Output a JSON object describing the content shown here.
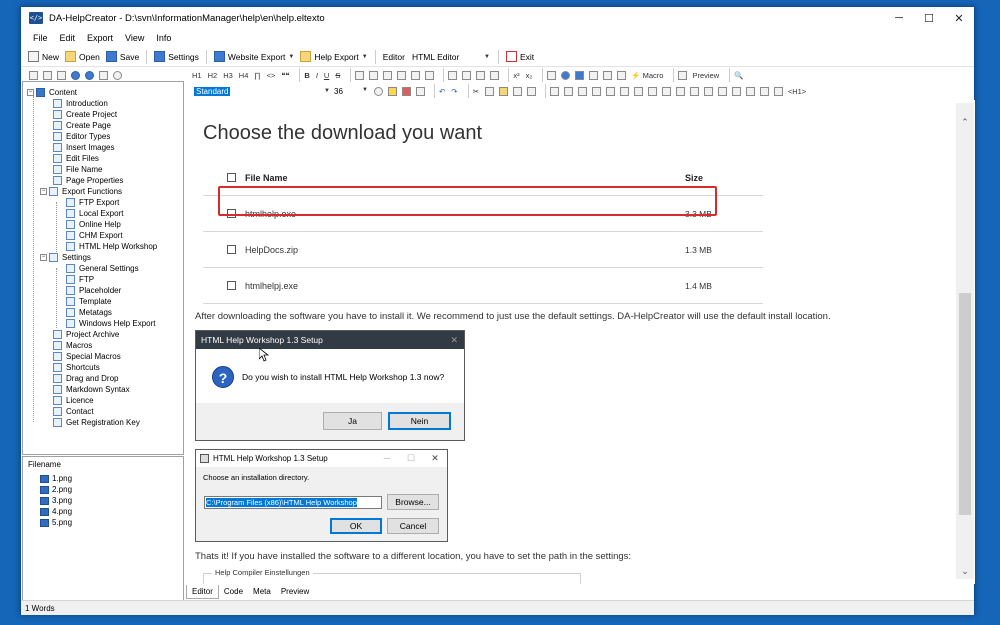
{
  "window": {
    "title": "DA-HelpCreator - D:\\svn\\InformationManager\\help\\en\\help.eltexto",
    "app_icon": "</>",
    "controls": {
      "minimize": "─",
      "maximize": "☐",
      "close": "✕"
    }
  },
  "menu": [
    "File",
    "Edit",
    "Export",
    "View",
    "Info"
  ],
  "toolbar": {
    "new": "New",
    "open": "Open",
    "save": "Save",
    "settings": "Settings",
    "website_export": "Website Export",
    "help_export": "Help Export",
    "editor_label": "Editor",
    "editor_value": "HTML Editor",
    "exit": "Exit"
  },
  "format_toolbar": {
    "items": [
      "H1",
      "H2",
      "H3",
      "H4",
      "∏",
      "<>",
      "❝❝",
      "B",
      "I",
      "U",
      "S",
      "x²",
      "x₂",
      "Macro",
      "Preview"
    ]
  },
  "style_toolbar": {
    "style": "Standard",
    "size": "36",
    "tag": "<H1>"
  },
  "tree": {
    "root": "Content",
    "items": [
      "Introduction",
      "Create Project",
      "Create Page",
      "Editor Types",
      "Insert Images",
      "Edit Files",
      "File Name",
      "Page Properties"
    ],
    "export_folder": "Export Functions",
    "export_items": [
      "FTP Export",
      "Local Export",
      "Online Help",
      "CHM Export",
      "HTML Help Workshop"
    ],
    "settings_folder": "Settings",
    "settings_items": [
      "General Settings",
      "FTP",
      "Placeholder",
      "Template",
      "Metatags",
      "Windows Help Export"
    ],
    "more_items": [
      "Project Archive",
      "Macros",
      "Special Macros",
      "Shortcuts",
      "Drag and Drop",
      "Markdown Syntax",
      "Licence",
      "Contact",
      "Get Registration Key"
    ]
  },
  "files": {
    "header": "Filename",
    "items": [
      "1.png",
      "2.png",
      "3.png",
      "4.png",
      "5.png"
    ]
  },
  "document": {
    "heading": "Choose the download you want",
    "table": {
      "col_name": "File Name",
      "col_size": "Size",
      "rows": [
        {
          "name": "htmlhelp.exe",
          "size": "3.3 MB"
        },
        {
          "name": "HelpDocs.zip",
          "size": "1.3 MB"
        },
        {
          "name": "htmlhelpj.exe",
          "size": "1.4 MB"
        }
      ]
    },
    "para1": "After downloading the software you have to install it. We recommend to just use the default settings. DA-HelpCreator will use the default install location.",
    "dialog1": {
      "title": "HTML Help Workshop 1.3 Setup",
      "close": "✕",
      "message": "Do you wish to install HTML Help Workshop 1.3 now?",
      "yes": "Ja",
      "no": "Nein"
    },
    "dialog2": {
      "title": "HTML Help Workshop 1.3 Setup",
      "label": "Choose an installation directory.",
      "path": "C:\\Program Files (x86)\\HTML Help Workshop",
      "browse": "Browse...",
      "ok": "OK",
      "cancel": "Cancel",
      "controls": {
        "minimize": "─",
        "maximize": "☐",
        "close": "✕"
      }
    },
    "para2": "Thats it! If you have installed the software to a different location, you have to set the path in the settings:",
    "fieldset_legend": "Help Compiler Einstellungen"
  },
  "editor_tabs": [
    "Editor",
    "Code",
    "Meta",
    "Preview"
  ],
  "status": "1 Words",
  "colors": {
    "background": "#1565b8",
    "highlight": "#d62c2c",
    "accent": "#0078d7"
  }
}
